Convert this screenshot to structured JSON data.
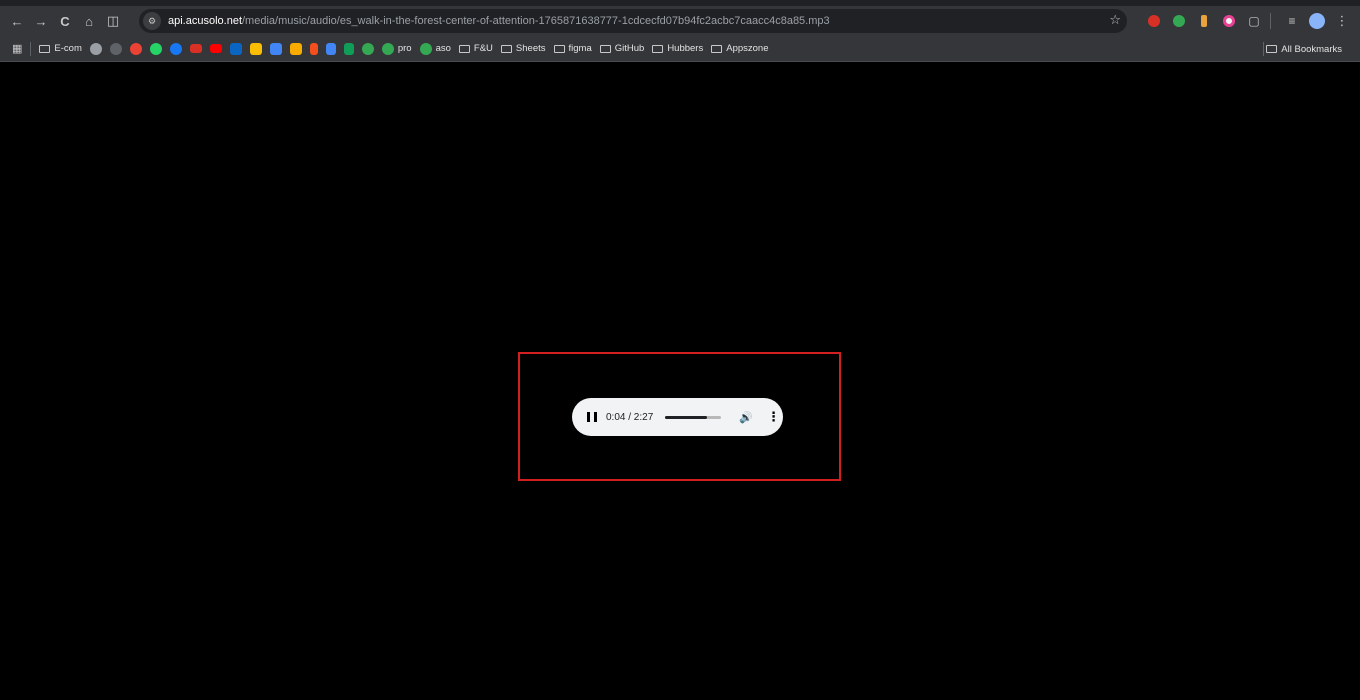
{
  "browser": {
    "nav": {
      "back_icon": "←",
      "forward_icon": "→",
      "reload_icon": "C",
      "home_icon": "⌂",
      "split_icon": "◫"
    },
    "address": {
      "domain": "api.acusolo.net",
      "path": "/media/music/audio/es_walk-in-the-forest-center-of-attention-1765871638777-1cdcecfd07b94fc2acbc7caacc4c8a85.mp3",
      "star_icon": "☆"
    }
  },
  "bookmarks": {
    "items": [
      {
        "label": "E-com",
        "type": "folder"
      },
      {
        "label": "pro",
        "type": "site",
        "color": "#1a73e8"
      },
      {
        "label": "aso",
        "type": "site",
        "color": "#1a73e8"
      },
      {
        "label": "F&U",
        "type": "folder"
      },
      {
        "label": "Sheets",
        "type": "folder"
      },
      {
        "label": "figma",
        "type": "folder"
      },
      {
        "label": "GitHub",
        "type": "folder"
      },
      {
        "label": "Hubbers",
        "type": "folder"
      },
      {
        "label": "Appszone",
        "type": "folder"
      }
    ],
    "all_bookmarks": "All Bookmarks"
  },
  "player": {
    "current_time": "0:04",
    "duration": "2:27",
    "time_display": "0:04 / 2:27",
    "progress_fraction": 0.75,
    "volume_icon": "🔊",
    "more_icon": "⋮",
    "state": "playing"
  },
  "colors": {
    "highlight_border": "#d21f1f",
    "player_bg": "#f1f3f4",
    "page_bg": "#000000"
  }
}
